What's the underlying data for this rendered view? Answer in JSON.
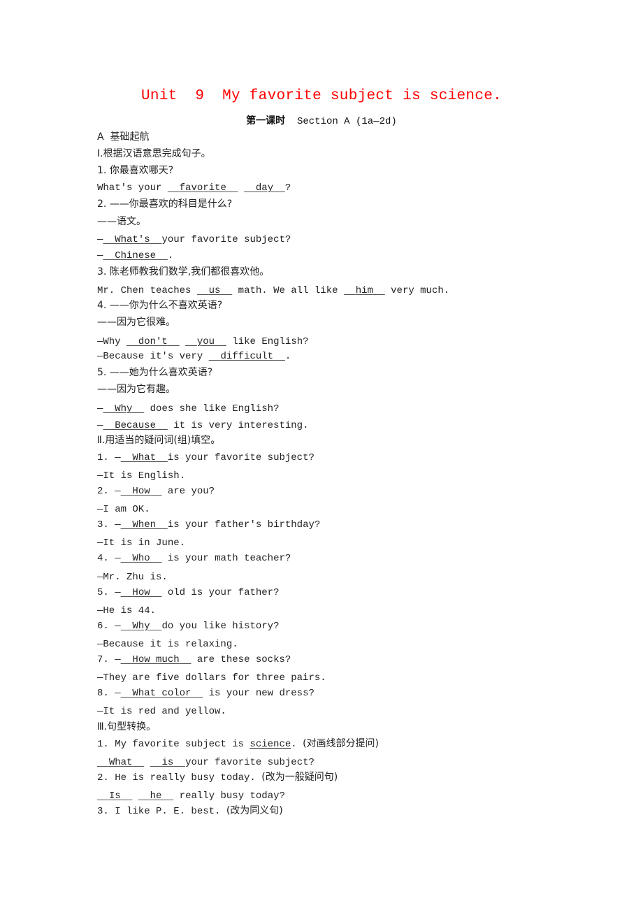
{
  "header": {
    "title": "Unit  9  My favorite subject is science.",
    "subtitle_cn": "第一课时",
    "subtitle_en": "  Section A (1a—2d)"
  },
  "part_a": {
    "label": "A  基础起航"
  },
  "section1": {
    "heading": "Ⅰ.根据汉语意思完成句子。",
    "items": [
      {
        "prompt": "1. 你最喜欢哪天?",
        "lines": [
          {
            "pre": "What's your ",
            "answers": [
              "favorite",
              "day"
            ],
            "mid": [
              " "
            ],
            "post": "?"
          }
        ]
      },
      {
        "prompt": "2. ——你最喜欢的科目是什么?",
        "sub": "——语文。",
        "lines": [
          {
            "pre": "—",
            "answers": [
              "What's"
            ],
            "post": "your favorite subject?"
          },
          {
            "pre": "—",
            "answers": [
              "Chinese"
            ],
            "post": "."
          }
        ]
      },
      {
        "prompt": "3. 陈老师教我们数学,我们都很喜欢他。",
        "lines": [
          {
            "pre": "Mr. Chen teaches ",
            "answers": [
              "us",
              "him"
            ],
            "mid": [
              " math. We all like "
            ],
            "post": " very much."
          }
        ]
      },
      {
        "prompt": "4. ——你为什么不喜欢英语?",
        "sub": "——因为它很难。",
        "lines": [
          {
            "pre": "—Why ",
            "answers": [
              "don't",
              "you"
            ],
            "mid": [
              " "
            ],
            "post": " like English?"
          },
          {
            "pre": "—Because it's very ",
            "answers": [
              "difficult"
            ],
            "post": "."
          }
        ]
      },
      {
        "prompt": "5. ——她为什么喜欢英语?",
        "sub": "——因为它有趣。",
        "lines": [
          {
            "pre": "—",
            "answers": [
              "Why"
            ],
            "post": " does she like English?"
          },
          {
            "pre": "—",
            "answers": [
              "Because"
            ],
            "post": " it is very interesting."
          }
        ]
      }
    ]
  },
  "section2": {
    "heading": "Ⅱ.用适当的疑问词(组)填空。",
    "items": [
      {
        "num": "1. —",
        "answer": "What",
        "question": "is your favorite subject?",
        "reply": "—It is English."
      },
      {
        "num": "2. —",
        "answer": "How",
        "question": " are you?",
        "reply": "—I am OK."
      },
      {
        "num": "3. —",
        "answer": "When",
        "question": "is your father's birthday?",
        "reply": "—It is in June."
      },
      {
        "num": "4. —",
        "answer": "Who",
        "question": " is your math teacher?",
        "reply": "—Mr. Zhu is."
      },
      {
        "num": "5. —",
        "answer": "How",
        "question": " old is your father?",
        "reply": "—He is 44."
      },
      {
        "num": "6. —",
        "answer": "Why",
        "question": "do you like history?",
        "reply": "—Because it is relaxing."
      },
      {
        "num": "7. —",
        "answer": "How much",
        "question": " are these socks?",
        "reply": "—They are five dollars for three pairs."
      },
      {
        "num": "8. —",
        "answer": "What color",
        "question": " is your new dress?",
        "reply": "—It is red and yellow."
      }
    ]
  },
  "section3": {
    "heading": "Ⅲ.句型转换。",
    "items": [
      {
        "prompt_pre": "1. My favorite subject is ",
        "prompt_underlined": "science",
        "prompt_post": ". ",
        "instruction": "(对画线部分提问)",
        "answers": [
          "What",
          "is"
        ],
        "answer_post": "your favorite subject?"
      },
      {
        "prompt_pre": "2. He is really busy today. ",
        "instruction": "(改为一般疑问句)",
        "answers": [
          "Is",
          "he"
        ],
        "answer_post": " really busy today?"
      },
      {
        "prompt_pre": "3. I like P. E. best. ",
        "instruction": "(改为同义句)"
      }
    ]
  }
}
